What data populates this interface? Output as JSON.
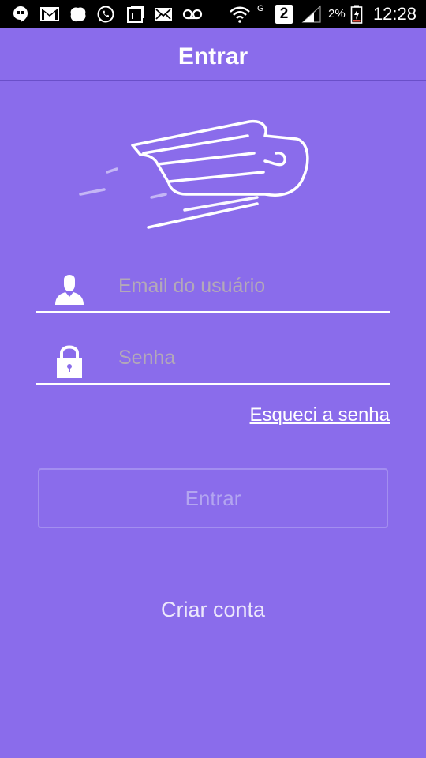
{
  "status_bar": {
    "time": "12:28",
    "battery_percent": "2%",
    "network_label": "G",
    "sim_badge": "2",
    "icons": [
      "hangouts-icon",
      "gmail-icon",
      "snap-icon",
      "whatsapp-icon",
      "screenshot-icon",
      "email-icon",
      "voicemail-icon",
      "wifi-icon",
      "signal-icon",
      "battery-icon"
    ]
  },
  "app_bar": {
    "title": "Entrar"
  },
  "login_form": {
    "email_placeholder": "Email do usuário",
    "email_value": "",
    "password_placeholder": "Senha",
    "password_value": "",
    "forgot_password_label": "Esqueci a senha",
    "submit_label": "Entrar"
  },
  "footer": {
    "create_account_label": "Criar conta"
  },
  "colors": {
    "background": "#8a6ceb",
    "status_bar": "#000000",
    "text": "#ffffff",
    "placeholder": "#b3a9b8",
    "button_border": "#a38ef0"
  }
}
